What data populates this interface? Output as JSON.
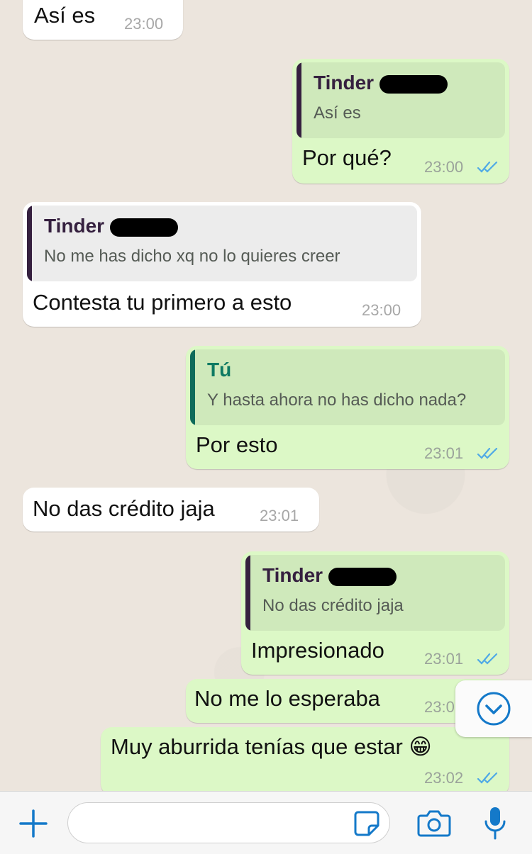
{
  "messages": [
    {
      "id": "m1",
      "type": "in",
      "text": "Así es",
      "time": "23:00"
    },
    {
      "id": "m2",
      "type": "out",
      "text": "Por qué?",
      "time": "23:00",
      "ticks": "read",
      "quote": {
        "author": "Tinder",
        "text": "Así es"
      }
    },
    {
      "id": "m3",
      "type": "in",
      "text": "Contesta tu primero a esto",
      "time": "23:00",
      "quote": {
        "author": "Tinder",
        "text": "No me has dicho xq no lo quieres creer"
      }
    },
    {
      "id": "m4",
      "type": "out",
      "text": "Por esto",
      "time": "23:01",
      "ticks": "read",
      "quote": {
        "author": "Tú",
        "text": "Y hasta ahora no has dicho nada?"
      }
    },
    {
      "id": "m5",
      "type": "in",
      "text": "No das crédito jaja",
      "time": "23:01"
    },
    {
      "id": "m6",
      "type": "out",
      "text": "Impresionado",
      "time": "23:01",
      "ticks": "read",
      "quote": {
        "author": "Tinder",
        "text": "No das crédito jaja"
      }
    },
    {
      "id": "m7",
      "type": "out",
      "text": "No me lo esperaba",
      "time": "23:0"
    },
    {
      "id": "m8",
      "type": "out",
      "text": "Muy aburrida tenías que estar 😁",
      "time": "23:02",
      "ticks": "read"
    }
  ],
  "colors": {
    "incoming_bubble": "#ffffff",
    "outgoing_bubble": "#dcf8c6",
    "quote_tinder_bar": "#35203f",
    "quote_self_bar": "#0f6b5a",
    "quote_self_author": "#0f7a63",
    "read_ticks": "#4fa9e6",
    "accent": "#1479c9"
  },
  "icons": {
    "scroll_down": "chevron-down-circle-icon",
    "attach": "plus-icon",
    "sticker": "sticker-icon",
    "camera": "camera-icon",
    "mic": "microphone-icon"
  }
}
